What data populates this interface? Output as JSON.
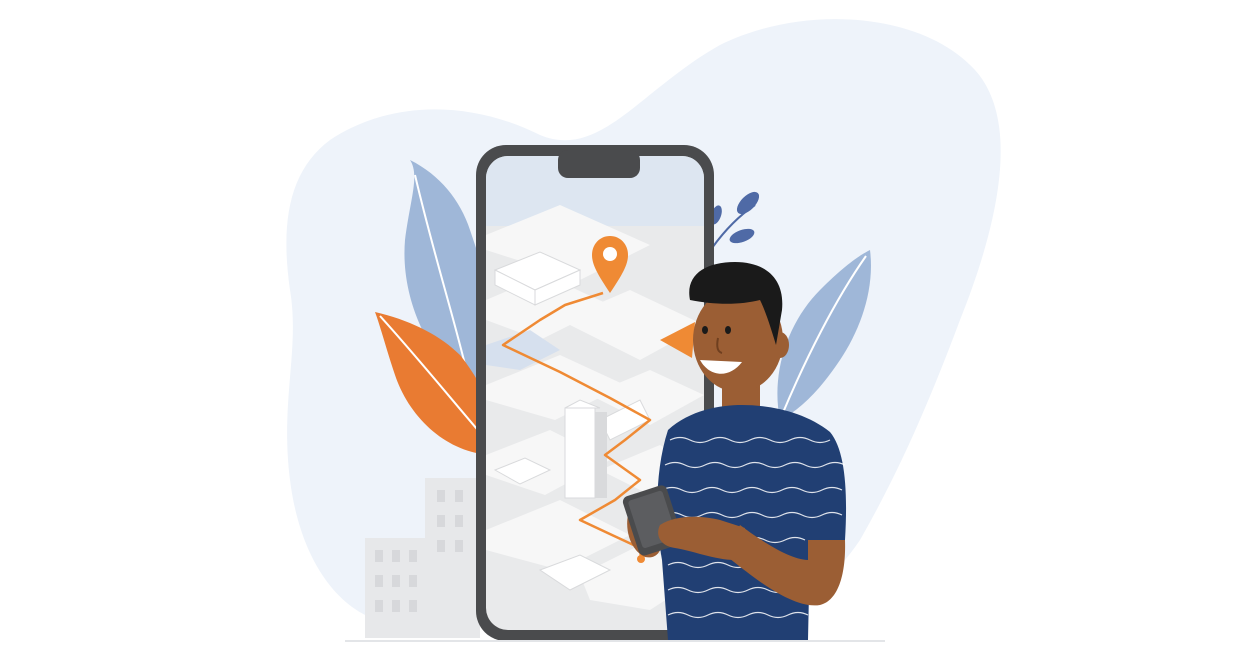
{
  "scene": {
    "description_free": true,
    "colors": {
      "background": "#ffffff",
      "blob": "#eef3fa",
      "phone_frame": "#4a4b4d",
      "map_base": "#e9eaeb",
      "map_block": "#f6f6f6",
      "map_shadow": "#d9dadc",
      "sky": "#dde6f1",
      "water": "#d6e0ee",
      "route": "#ef8a34",
      "pin": "#ef8a34",
      "leaf_blue": "#9fb7d8",
      "leaf_dark_blue": "#4f6aa6",
      "leaf_orange": "#e97b32",
      "buildings": "#e7e8ea",
      "skin": "#9b5e34",
      "hair": "#1a1a1a",
      "shirt": "#213f73",
      "shirt_wave": "#ffffff",
      "small_phone": "#4a4b4d"
    },
    "icons": {
      "pin": "map-pin-icon",
      "arrow": "navigation-arrow-icon"
    }
  }
}
